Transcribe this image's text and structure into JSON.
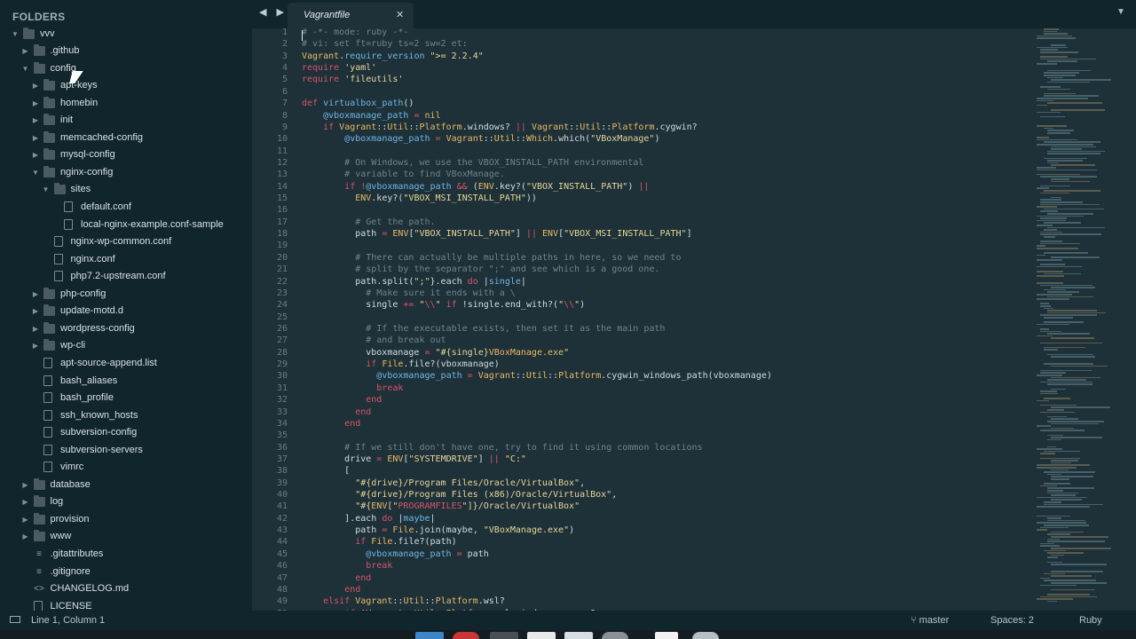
{
  "sidebar": {
    "header": "FOLDERS",
    "tree": [
      {
        "label": "vvv",
        "depth": 0,
        "type": "folder",
        "open": true
      },
      {
        "label": ".github",
        "depth": 1,
        "type": "folder",
        "open": false
      },
      {
        "label": "config",
        "depth": 1,
        "type": "folder",
        "open": true
      },
      {
        "label": "apt-keys",
        "depth": 2,
        "type": "folder",
        "open": false
      },
      {
        "label": "homebin",
        "depth": 2,
        "type": "folder",
        "open": false
      },
      {
        "label": "init",
        "depth": 2,
        "type": "folder",
        "open": false
      },
      {
        "label": "memcached-config",
        "depth": 2,
        "type": "folder",
        "open": false
      },
      {
        "label": "mysql-config",
        "depth": 2,
        "type": "folder",
        "open": false
      },
      {
        "label": "nginx-config",
        "depth": 2,
        "type": "folder",
        "open": true
      },
      {
        "label": "sites",
        "depth": 3,
        "type": "folder",
        "open": true
      },
      {
        "label": "default.conf",
        "depth": 4,
        "type": "file"
      },
      {
        "label": "local-nginx-example.conf-sample",
        "depth": 4,
        "type": "file"
      },
      {
        "label": "nginx-wp-common.conf",
        "depth": 3,
        "type": "file"
      },
      {
        "label": "nginx.conf",
        "depth": 3,
        "type": "file"
      },
      {
        "label": "php7.2-upstream.conf",
        "depth": 3,
        "type": "file"
      },
      {
        "label": "php-config",
        "depth": 2,
        "type": "folder",
        "open": false
      },
      {
        "label": "update-motd.d",
        "depth": 2,
        "type": "folder",
        "open": false
      },
      {
        "label": "wordpress-config",
        "depth": 2,
        "type": "folder",
        "open": false
      },
      {
        "label": "wp-cli",
        "depth": 2,
        "type": "folder",
        "open": false
      },
      {
        "label": "apt-source-append.list",
        "depth": 2,
        "type": "file"
      },
      {
        "label": "bash_aliases",
        "depth": 2,
        "type": "file"
      },
      {
        "label": "bash_profile",
        "depth": 2,
        "type": "file"
      },
      {
        "label": "ssh_known_hosts",
        "depth": 2,
        "type": "file"
      },
      {
        "label": "subversion-config",
        "depth": 2,
        "type": "file"
      },
      {
        "label": "subversion-servers",
        "depth": 2,
        "type": "file"
      },
      {
        "label": "vimrc",
        "depth": 2,
        "type": "file"
      },
      {
        "label": "database",
        "depth": 1,
        "type": "folder",
        "open": false
      },
      {
        "label": "log",
        "depth": 1,
        "type": "folder",
        "open": false
      },
      {
        "label": "provision",
        "depth": 1,
        "type": "folder",
        "open": false
      },
      {
        "label": "www",
        "depth": 1,
        "type": "folder",
        "open": false
      },
      {
        "label": ".gitattributes",
        "depth": 1,
        "type": "glyph",
        "icon": "lines-icon"
      },
      {
        "label": ".gitignore",
        "depth": 1,
        "type": "glyph",
        "icon": "lines-icon"
      },
      {
        "label": "CHANGELOG.md",
        "depth": 1,
        "type": "glyph",
        "icon": "code-icon"
      },
      {
        "label": "LICENSE",
        "depth": 1,
        "type": "file"
      }
    ]
  },
  "tabbar": {
    "nav_arrows": "◀ ▶",
    "active_tab": "Vagrantfile",
    "close_glyph": "✕",
    "dropdown_glyph": "▼"
  },
  "editor": {
    "lines": [
      [
        [
          "c-cmt",
          "# -*- mode: ruby -*-"
        ]
      ],
      [
        [
          "c-cmt",
          "# vi: set ft=ruby ts=2 sw=2 et:"
        ]
      ],
      [
        [
          "c-cls",
          "Vagrant"
        ],
        [
          "",
          "."
        ],
        [
          "c-fn",
          "require_version"
        ],
        [
          "",
          " "
        ],
        [
          "c-str",
          "\">= 2.2.4\""
        ]
      ],
      [
        [
          "c-kw",
          "require"
        ],
        [
          "",
          " "
        ],
        [
          "c-str",
          "'yaml'"
        ]
      ],
      [
        [
          "c-kw",
          "require"
        ],
        [
          "",
          " "
        ],
        [
          "c-str",
          "'fileutils'"
        ]
      ],
      [
        [
          "",
          ""
        ]
      ],
      [
        [
          "c-kw",
          "def"
        ],
        [
          "",
          " "
        ],
        [
          "c-fn",
          "virtualbox_path"
        ],
        [
          "",
          "()"
        ]
      ],
      [
        [
          "",
          "    "
        ],
        [
          "c-ivar",
          "@vboxmanage_path"
        ],
        [
          "",
          " "
        ],
        [
          "c-kw",
          "="
        ],
        [
          "",
          " "
        ],
        [
          "c-cls",
          "nil"
        ]
      ],
      [
        [
          "",
          "    "
        ],
        [
          "c-kw",
          "if"
        ],
        [
          "",
          " "
        ],
        [
          "c-cls",
          "Vagrant"
        ],
        [
          "",
          "::"
        ],
        [
          "c-cls",
          "Util"
        ],
        [
          "",
          "::"
        ],
        [
          "c-cls",
          "Platform"
        ],
        [
          "",
          ".windows? "
        ],
        [
          "c-kw",
          "||"
        ],
        [
          "",
          " "
        ],
        [
          "c-cls",
          "Vagrant"
        ],
        [
          "",
          "::"
        ],
        [
          "c-cls",
          "Util"
        ],
        [
          "",
          "::"
        ],
        [
          "c-cls",
          "Platform"
        ],
        [
          "",
          ".cygwin?"
        ]
      ],
      [
        [
          "",
          "        "
        ],
        [
          "c-ivar",
          "@vboxmanage_path"
        ],
        [
          "",
          " "
        ],
        [
          "c-kw",
          "="
        ],
        [
          "",
          " "
        ],
        [
          "c-cls",
          "Vagrant"
        ],
        [
          "",
          "::"
        ],
        [
          "c-cls",
          "Util"
        ],
        [
          "",
          "::"
        ],
        [
          "c-cls",
          "Which"
        ],
        [
          "",
          ".which("
        ],
        [
          "c-str",
          "\"VBoxManage\""
        ],
        [
          "",
          ")"
        ]
      ],
      [
        [
          "",
          ""
        ]
      ],
      [
        [
          "",
          "        "
        ],
        [
          "c-cmt",
          "# On Windows, we use the VBOX_INSTALL_PATH environmental"
        ]
      ],
      [
        [
          "",
          "        "
        ],
        [
          "c-cmt",
          "# variable to find VBoxManage."
        ]
      ],
      [
        [
          "",
          "        "
        ],
        [
          "c-kw",
          "if"
        ],
        [
          "",
          " "
        ],
        [
          "c-kw",
          "!"
        ],
        [
          "c-ivar",
          "@vboxmanage_path"
        ],
        [
          "",
          " "
        ],
        [
          "c-kw",
          "&&"
        ],
        [
          "",
          " ("
        ],
        [
          "c-cls",
          "ENV"
        ],
        [
          "",
          ".key?("
        ],
        [
          "c-str",
          "\"VBOX_INSTALL_PATH\""
        ],
        [
          "",
          ") "
        ],
        [
          "c-kw",
          "||"
        ]
      ],
      [
        [
          "",
          "          "
        ],
        [
          "c-cls",
          "ENV"
        ],
        [
          "",
          ".key?("
        ],
        [
          "c-str",
          "\"VBOX_MSI_INSTALL_PATH\""
        ],
        [
          "",
          "))"
        ]
      ],
      [
        [
          "",
          ""
        ]
      ],
      [
        [
          "",
          "          "
        ],
        [
          "c-cmt",
          "# Get the path."
        ]
      ],
      [
        [
          "",
          "          "
        ],
        [
          "",
          "path "
        ],
        [
          "c-kw",
          "="
        ],
        [
          "",
          " "
        ],
        [
          "c-cls",
          "ENV"
        ],
        [
          "",
          "["
        ],
        [
          "c-str",
          "\"VBOX_INSTALL_PATH\""
        ],
        [
          "",
          "] "
        ],
        [
          "c-kw",
          "||"
        ],
        [
          "",
          " "
        ],
        [
          "c-cls",
          "ENV"
        ],
        [
          "",
          "["
        ],
        [
          "c-str",
          "\"VBOX_MSI_INSTALL_PATH\""
        ],
        [
          "",
          "]"
        ]
      ],
      [
        [
          "",
          ""
        ]
      ],
      [
        [
          "",
          "          "
        ],
        [
          "c-cmt",
          "# There can actually be multiple paths in here, so we need to"
        ]
      ],
      [
        [
          "",
          "          "
        ],
        [
          "c-cmt",
          "# split by the separator \";\" and see which is a good one."
        ]
      ],
      [
        [
          "",
          "          "
        ],
        [
          "",
          "path.split("
        ],
        [
          "c-str",
          "\";\""
        ],
        [
          "",
          "}.each "
        ],
        [
          "c-kw",
          "do"
        ],
        [
          "",
          " |"
        ],
        [
          "c-fn",
          "single"
        ],
        [
          "",
          "|"
        ]
      ],
      [
        [
          "",
          "            "
        ],
        [
          "c-cmt",
          "# Make sure it ends with a \\"
        ]
      ],
      [
        [
          "",
          "            "
        ],
        [
          "",
          "single "
        ],
        [
          "c-kw",
          "+="
        ],
        [
          "",
          " "
        ],
        [
          "c-str",
          "\""
        ],
        [
          "c-interp",
          "\\\\"
        ],
        [
          "c-str",
          "\""
        ],
        [
          "",
          " "
        ],
        [
          "c-kw",
          "if"
        ],
        [
          "",
          " !single.end_with?("
        ],
        [
          "c-str",
          "\""
        ],
        [
          "c-interp",
          "\\\\"
        ],
        [
          "c-str",
          "\""
        ],
        [
          "",
          ")"
        ]
      ],
      [
        [
          "",
          ""
        ]
      ],
      [
        [
          "",
          "            "
        ],
        [
          "c-cmt",
          "# If the executable exists, then set it as the main path"
        ]
      ],
      [
        [
          "",
          "            "
        ],
        [
          "c-cmt",
          "# and break out"
        ]
      ],
      [
        [
          "",
          "            "
        ],
        [
          "",
          "vboxmanage "
        ],
        [
          "c-kw",
          "="
        ],
        [
          "",
          " "
        ],
        [
          "c-str",
          "\"#{single}"
        ],
        [
          "c-cls",
          "VBoxManage.exe"
        ],
        [
          "c-str",
          "\""
        ]
      ],
      [
        [
          "",
          "            "
        ],
        [
          "c-kw",
          "if"
        ],
        [
          "",
          " "
        ],
        [
          "c-cls",
          "File"
        ],
        [
          "",
          ".file?(vboxmanage)"
        ]
      ],
      [
        [
          "",
          "              "
        ],
        [
          "c-ivar",
          "@vboxmanage_path"
        ],
        [
          "",
          " "
        ],
        [
          "c-kw",
          "="
        ],
        [
          "",
          " "
        ],
        [
          "c-cls",
          "Vagrant"
        ],
        [
          "",
          "::"
        ],
        [
          "c-cls",
          "Util"
        ],
        [
          "",
          "::"
        ],
        [
          "c-cls",
          "Platform"
        ],
        [
          "",
          ".cygwin_windows_path(vboxmanage)"
        ]
      ],
      [
        [
          "",
          "              "
        ],
        [
          "c-kw",
          "break"
        ]
      ],
      [
        [
          "",
          "            "
        ],
        [
          "c-kw",
          "end"
        ]
      ],
      [
        [
          "",
          "          "
        ],
        [
          "c-kw",
          "end"
        ]
      ],
      [
        [
          "",
          "        "
        ],
        [
          "c-kw",
          "end"
        ]
      ],
      [
        [
          "",
          ""
        ]
      ],
      [
        [
          "",
          "        "
        ],
        [
          "c-cmt",
          "# If we still don't have one, try to find it using common locations"
        ]
      ],
      [
        [
          "",
          "        "
        ],
        [
          "",
          "drive "
        ],
        [
          "c-kw",
          "="
        ],
        [
          "",
          " "
        ],
        [
          "c-cls",
          "ENV"
        ],
        [
          "",
          "["
        ],
        [
          "c-str",
          "\"SYSTEMDRIVE\""
        ],
        [
          "",
          "] "
        ],
        [
          "c-kw",
          "||"
        ],
        [
          "",
          " "
        ],
        [
          "c-str",
          "\"C:\""
        ]
      ],
      [
        [
          "",
          "        "
        ],
        [
          "",
          "["
        ]
      ],
      [
        [
          "",
          "          "
        ],
        [
          "c-str",
          "\"#{drive}/Program Files/Oracle/VirtualBox\""
        ],
        [
          "",
          ","
        ]
      ],
      [
        [
          "",
          "          "
        ],
        [
          "c-str",
          "\"#{drive}/Program Files (x86)/Oracle/VirtualBox\""
        ],
        [
          "",
          ","
        ]
      ],
      [
        [
          "",
          "          "
        ],
        [
          "c-str",
          "\"#{"
        ],
        [
          "c-cls",
          "ENV"
        ],
        [
          "c-str",
          "[\""
        ],
        [
          "c-interp",
          "PROGRAMFILES"
        ],
        [
          "c-str",
          "\"]}/Oracle/VirtualBox\""
        ]
      ],
      [
        [
          "",
          "        "
        ],
        [
          "",
          "].each "
        ],
        [
          "c-kw",
          "do"
        ],
        [
          "",
          " |"
        ],
        [
          "c-fn",
          "maybe"
        ],
        [
          "",
          "|"
        ]
      ],
      [
        [
          "",
          "          "
        ],
        [
          "",
          "path "
        ],
        [
          "c-kw",
          "="
        ],
        [
          "",
          " "
        ],
        [
          "c-cls",
          "File"
        ],
        [
          "",
          ".join(maybe, "
        ],
        [
          "c-str",
          "\"VBoxManage.exe\""
        ],
        [
          "",
          ")"
        ]
      ],
      [
        [
          "",
          "          "
        ],
        [
          "c-kw",
          "if"
        ],
        [
          "",
          " "
        ],
        [
          "c-cls",
          "File"
        ],
        [
          "",
          ".file?(path)"
        ]
      ],
      [
        [
          "",
          "            "
        ],
        [
          "c-ivar",
          "@vboxmanage_path"
        ],
        [
          "",
          " "
        ],
        [
          "c-kw",
          "="
        ],
        [
          "",
          " path"
        ]
      ],
      [
        [
          "",
          "            "
        ],
        [
          "c-kw",
          "break"
        ]
      ],
      [
        [
          "",
          "          "
        ],
        [
          "c-kw",
          "end"
        ]
      ],
      [
        [
          "",
          "        "
        ],
        [
          "c-kw",
          "end"
        ]
      ],
      [
        [
          "",
          "    "
        ],
        [
          "c-kw",
          "elsif"
        ],
        [
          "",
          " "
        ],
        [
          "c-cls",
          "Vagrant"
        ],
        [
          "",
          "::"
        ],
        [
          "c-cls",
          "Util"
        ],
        [
          "",
          "::"
        ],
        [
          "c-cls",
          "Platform"
        ],
        [
          "",
          ".wsl?"
        ]
      ],
      [
        [
          "",
          "        "
        ],
        [
          "c-kw",
          "if"
        ],
        [
          "",
          " !"
        ],
        [
          "c-cls",
          "Vagrant"
        ],
        [
          "",
          "::"
        ],
        [
          "c-cls",
          "Util"
        ],
        [
          "",
          "::"
        ],
        [
          "c-cls",
          "Platform"
        ],
        [
          "",
          ".wsl_windows_access?"
        ]
      ]
    ]
  },
  "status": {
    "position": "Line 1, Column 1",
    "branch": "master",
    "indentation": "Spaces: 2",
    "syntax": "Ruby"
  }
}
